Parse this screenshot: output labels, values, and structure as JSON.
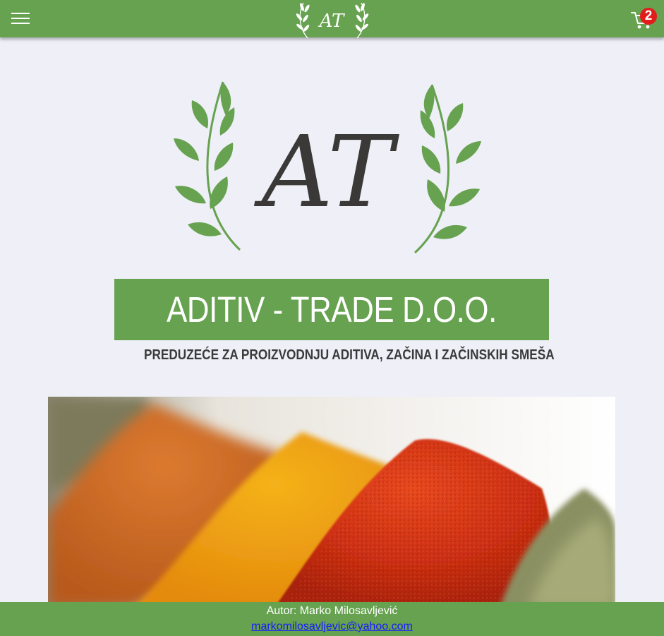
{
  "header": {
    "menu_icon": "hamburger-menu-icon",
    "logo_monogram": "AT",
    "cart_icon": "shopping-cart-icon",
    "cart_count": "2",
    "bar_color": "#66a24f",
    "badge_color": "#e21b1b"
  },
  "hero": {
    "logo_monogram": "AT",
    "company_name": "ADITIV - TRADE D.O.O.",
    "tagline": "PREDUZEĆE ZA PROIZVODNJU ADITIVA, ZAČINA I ZAČINSKIH SMEŠA",
    "leaf_color": "#66a24f"
  },
  "main": {
    "image_subject": "spice-powders-photo"
  },
  "footer": {
    "author": "Autor: Marko Milosavljević",
    "email": "markomilosavljevic@yahoo.com"
  }
}
